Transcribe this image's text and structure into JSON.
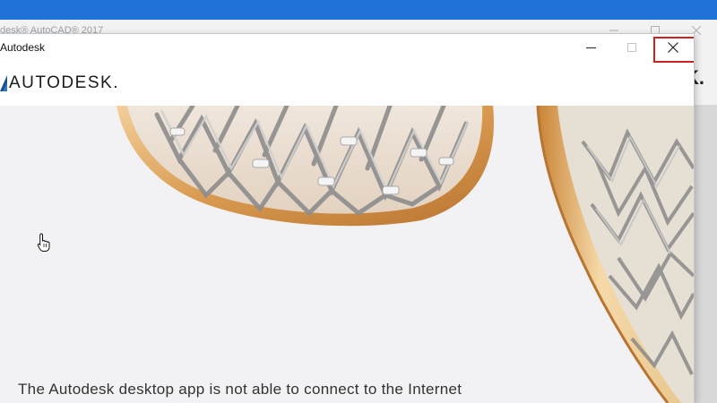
{
  "background_window": {
    "title": "desk® AutoCAD® 2017",
    "partial_logo_text": "K."
  },
  "dialog": {
    "title": "Autodesk",
    "logo_text": "AUTODESK",
    "logo_suffix": ".",
    "message": "The Autodesk desktop app is not able to connect to the Internet",
    "controls": {
      "minimize_icon": "minimize-icon",
      "maximize_icon": "maximize-icon",
      "close_icon": "close-icon"
    }
  },
  "colors": {
    "highlight_box": "#d21f1f",
    "hero_bg": "#f2f1f3",
    "sculpture_gold": "#d9a566",
    "sculpture_silver": "#b8b8b8"
  }
}
